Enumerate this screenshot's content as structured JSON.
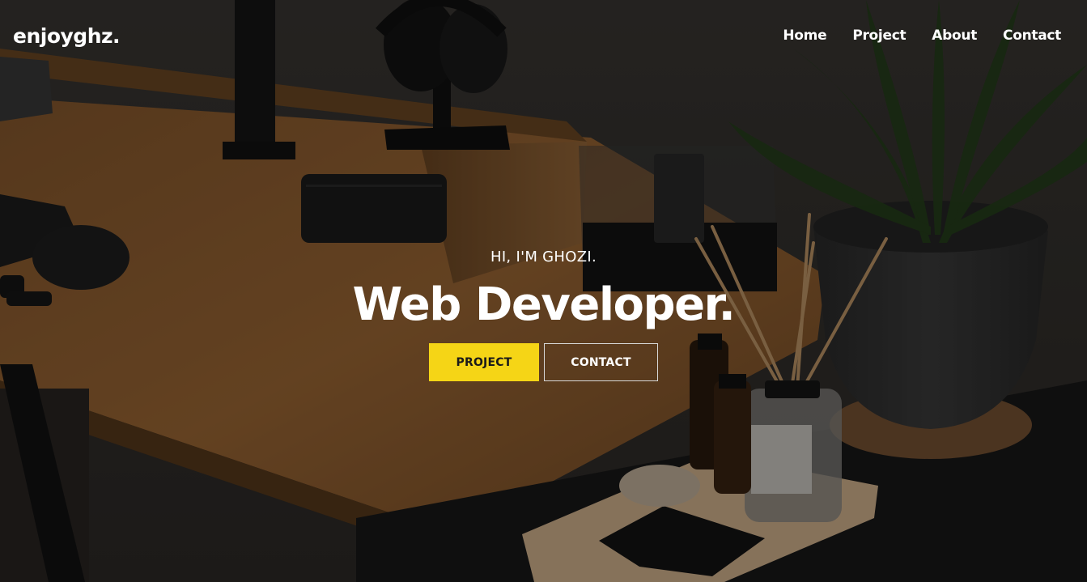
{
  "brand": {
    "name": "enjoyghz."
  },
  "nav": {
    "items": [
      {
        "label": "Home"
      },
      {
        "label": "Project"
      },
      {
        "label": "About"
      },
      {
        "label": "Contact"
      }
    ]
  },
  "hero": {
    "greeting": "HI, I'M GHOZI.",
    "headline": "Web Developer.",
    "primary_cta": "PROJECT",
    "secondary_cta": "CONTACT"
  },
  "colors": {
    "accent": "#f5d516",
    "text": "#ffffff"
  }
}
